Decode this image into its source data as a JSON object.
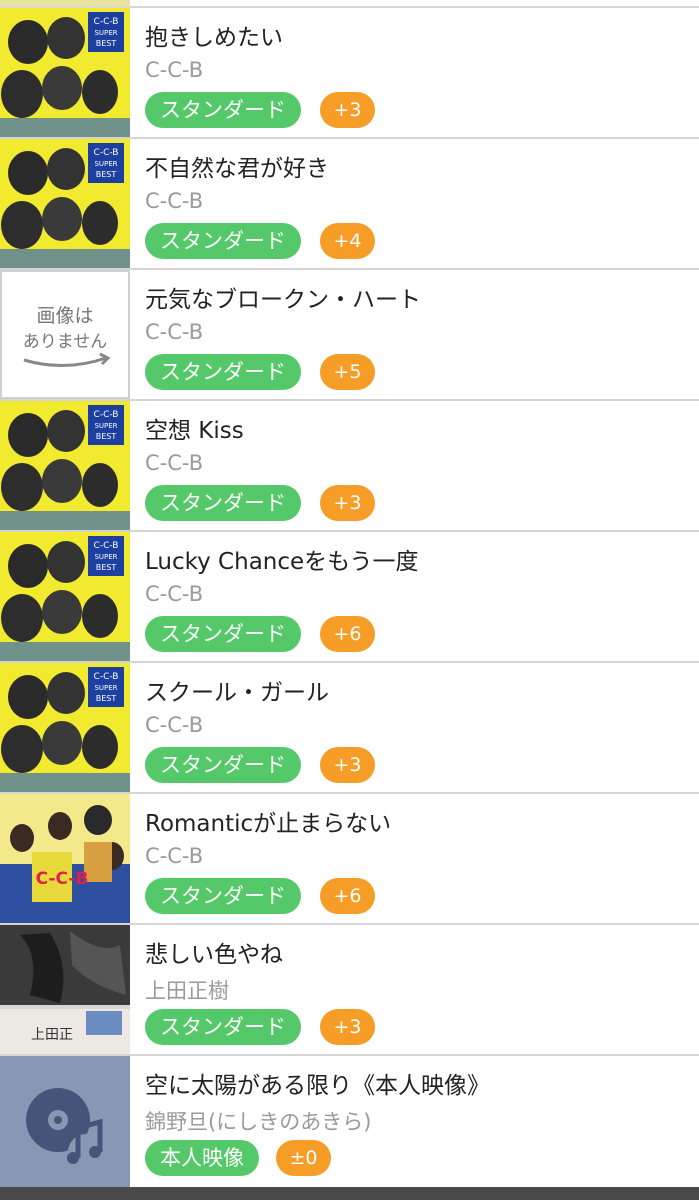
{
  "songs": [
    {
      "title": "抱きしめたい",
      "artist": "C-C-B",
      "tag": "スタンダード",
      "score": "+3",
      "thumb": "ccb-super-best"
    },
    {
      "title": "不自然な君が好き",
      "artist": "C-C-B",
      "tag": "スタンダード",
      "score": "+4",
      "thumb": "ccb-super-best"
    },
    {
      "title": "元気なブロークン・ハート",
      "artist": "C-C-B",
      "tag": "スタンダード",
      "score": "+5",
      "thumb": "no-image",
      "no_image_text": [
        "画像は",
        "ありません"
      ]
    },
    {
      "title": "空想 Kiss",
      "artist": "C-C-B",
      "tag": "スタンダード",
      "score": "+3",
      "thumb": "ccb-super-best"
    },
    {
      "title": "Lucky Chanceをもう一度",
      "artist": "C-C-B",
      "tag": "スタンダード",
      "score": "+6",
      "thumb": "ccb-super-best"
    },
    {
      "title": "スクール・ガール",
      "artist": "C-C-B",
      "tag": "スタンダード",
      "score": "+3",
      "thumb": "ccb-super-best"
    },
    {
      "title": "Romanticが止まらない",
      "artist": "C-C-B",
      "tag": "スタンダード",
      "score": "+6",
      "thumb": "ccb-romantic"
    },
    {
      "title": "悲しい色やね",
      "artist": "上田正樹",
      "tag": "スタンダード",
      "score": "+3",
      "thumb": "ueda-album"
    },
    {
      "title": "空に太陽がある限り《本人映像》",
      "artist": "錦野旦(にしきのあきら)",
      "tag": "本人映像",
      "score": "±0",
      "thumb": "video-disc-music-icon"
    }
  ],
  "colors": {
    "standard_tag": "#55c96a",
    "score_tag": "#f59d26",
    "title_text": "#222222",
    "artist_text": "#9a9a9a",
    "divider": "#d5d5d5"
  }
}
